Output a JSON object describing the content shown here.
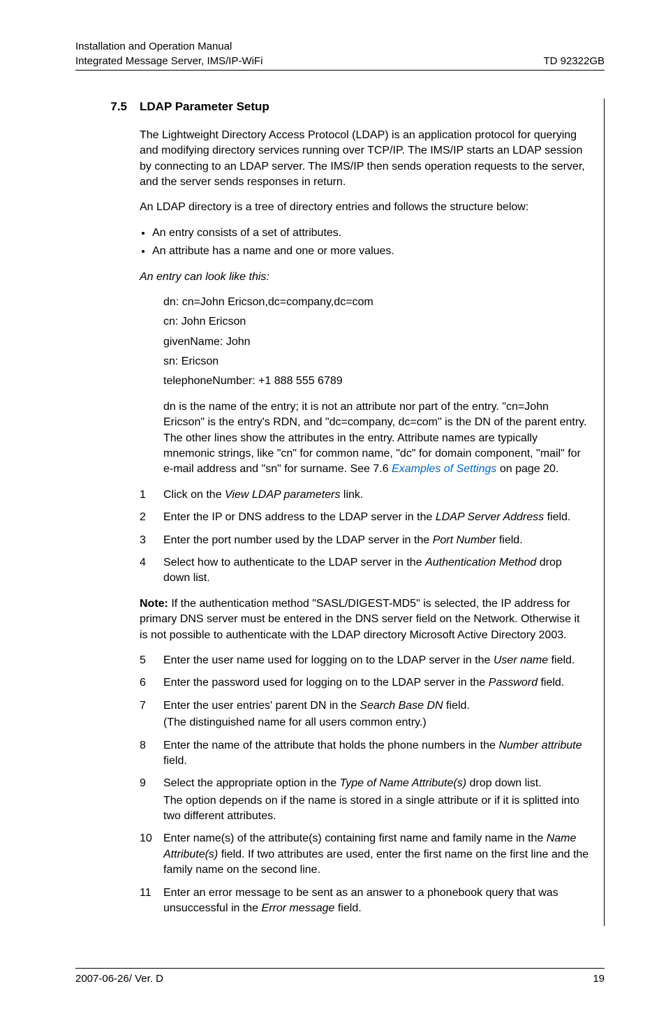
{
  "header": {
    "left_line1": "Installation and Operation Manual",
    "left_line2": "Integrated Message Server, IMS/IP-WiFi",
    "right": "TD 92322GB"
  },
  "section": {
    "number": "7.5",
    "title": "LDAP Parameter Setup"
  },
  "paragraphs": {
    "p1": "The Lightweight Directory Access Protocol (LDAP) is an application protocol for querying and modifying directory services running over TCP/IP. The IMS/IP starts an LDAP session by connecting to an LDAP server. The IMS/IP then sends operation requests to the server, and the server sends responses in return.",
    "p2": "An LDAP directory is a tree of directory entries and follows the structure below:",
    "p3": "An entry can look like this:",
    "p4_pre": "dn is the name of the entry; it is not an attribute nor part of the entry. \"cn=John Ericson\" is the entry's RDN, and \"dc=company, dc=com\" is the DN of the parent entry. The other lines show the attributes in the entry. Attribute names are typically mnemonic strings, like \"cn\" for common name, \"dc\" for domain component, \"mail\" for e-mail address and \"sn\" for surname. See ",
    "p4_link": "7.6 Examples of Settings",
    "p4_post": " on page 20.",
    "note_label": "Note:",
    "note_body": " If the authentication method \"SASL/DIGEST-MD5\" is selected, the IP address for primary DNS server must be entered in the DNS server field on the Network. Otherwise it is not possible to authenticate with the LDAP directory Microsoft Active Directory 2003."
  },
  "bullets": [
    "An entry consists of a set of attributes.",
    "An attribute has a name and one or more values."
  ],
  "dn_example": [
    "dn: cn=John Ericson,dc=company,dc=com",
    "cn: John Ericson",
    "givenName: John",
    "sn: Ericson",
    "telephoneNumber: +1 888 555 6789"
  ],
  "steps_a": [
    {
      "n": "1",
      "pre": "Click on the ",
      "em": "View LDAP parameters",
      "post": " link."
    },
    {
      "n": "2",
      "pre": "Enter the IP or DNS address to the LDAP server in the ",
      "em": "LDAP Server Address",
      "post": " field."
    },
    {
      "n": "3",
      "pre": "Enter the port number used by the LDAP server in the ",
      "em": "Port Number",
      "post": " field."
    },
    {
      "n": "4",
      "pre": "Select how to authenticate to the LDAP server in the ",
      "em": "Authentication Method",
      "post": " drop down list."
    }
  ],
  "steps_b": [
    {
      "n": "5",
      "pre": "Enter the user name used for logging on to the LDAP server in the ",
      "em": "User name",
      "post": " field."
    },
    {
      "n": "6",
      "pre": "Enter the password used for logging on to the LDAP server in the ",
      "em": "Password",
      "post": " field."
    },
    {
      "n": "7",
      "pre": "Enter the user entries' parent DN in the ",
      "em": "Search Base DN",
      "post": " field.",
      "sub": "(The distinguished name for all users common entry.)"
    },
    {
      "n": "8",
      "pre": "Enter the name of the attribute that holds the phone numbers in the ",
      "em": "Number attribute",
      "post": " field."
    },
    {
      "n": "9",
      "pre": "Select the appropriate option in the ",
      "em": "Type of Name Attribute(s)",
      "post": " drop down list.",
      "subplain": "The option depends on if the name is stored in a single attribute or if it is splitted into two different attributes."
    },
    {
      "n": "10",
      "pre": "Enter name(s) of the attribute(s) containing first name and family name in the ",
      "em": "Name Attribute(s)",
      "post": " field. If two attributes are used, enter the first name on the first line and the family name on the second line."
    },
    {
      "n": "11",
      "pre": "Enter an error message to be sent as an answer to a phonebook query that was unsuccessful in the ",
      "em": "Error message",
      "post": " field."
    }
  ],
  "footer": {
    "left": "2007-06-26/ Ver. D",
    "right": "19"
  }
}
